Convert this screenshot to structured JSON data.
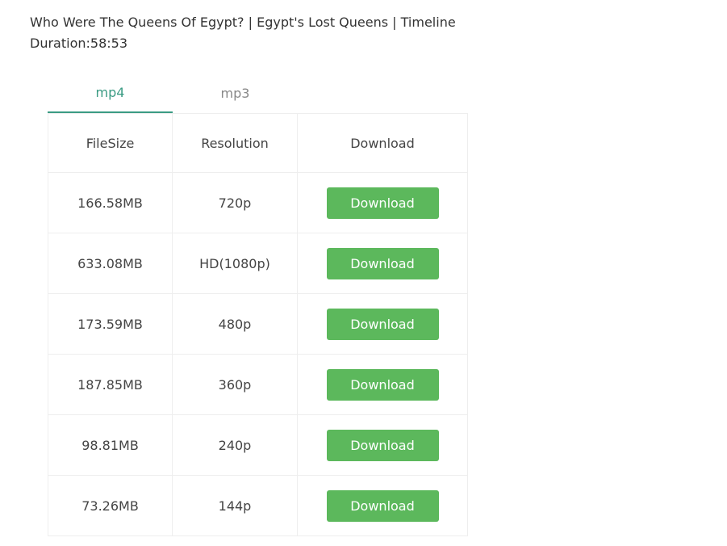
{
  "video": {
    "title": "Who Were The Queens Of Egypt? | Egypt's Lost Queens | Timeline",
    "duration": "Duration:58:53"
  },
  "tabs": [
    {
      "label": "mp4",
      "active": true
    },
    {
      "label": "mp3",
      "active": false
    }
  ],
  "table": {
    "headers": [
      "FileSize",
      "Resolution",
      "Download"
    ],
    "rows": [
      {
        "size": "166.58MB",
        "resolution": "720p",
        "button": "Download"
      },
      {
        "size": "633.08MB",
        "resolution": "HD(1080p)",
        "button": "Download"
      },
      {
        "size": "173.59MB",
        "resolution": "480p",
        "button": "Download"
      },
      {
        "size": "187.85MB",
        "resolution": "360p",
        "button": "Download"
      },
      {
        "size": "98.81MB",
        "resolution": "240p",
        "button": "Download"
      },
      {
        "size": "73.26MB",
        "resolution": "144p",
        "button": "Download"
      }
    ]
  },
  "colors": {
    "accent": "#3a9b83",
    "button": "#5cb85c",
    "button_text": "#ffffff",
    "border": "#eeeeee"
  }
}
